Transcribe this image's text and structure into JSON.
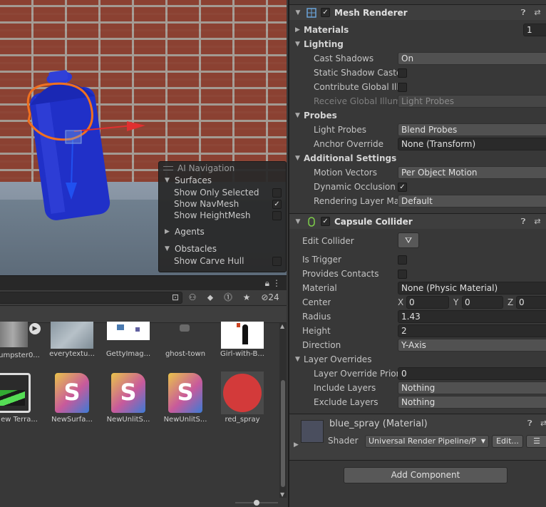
{
  "ai_navigation": {
    "title": "AI Navigation",
    "sections": {
      "surfaces": "Surfaces",
      "agents": "Agents",
      "obstacles": "Obstacles"
    },
    "options": {
      "show_only_selected": "Show Only Selected",
      "show_navmesh": "Show NavMesh",
      "show_heightmesh": "Show HeightMesh",
      "show_carve_hull": "Show Carve Hull"
    },
    "checked": {
      "show_only_selected": false,
      "show_navmesh": true,
      "show_heightmesh": false,
      "show_carve_hull": false
    }
  },
  "project": {
    "hidden_count": "24",
    "assets": [
      {
        "label": "umpster0...",
        "kind": "dumpster"
      },
      {
        "label": "everytextu...",
        "kind": "texture"
      },
      {
        "label": "GettyImag...",
        "kind": "image"
      },
      {
        "label": "ghost-town",
        "kind": "ghost"
      },
      {
        "label": "Girl-with-B...",
        "kind": "girl"
      },
      {
        "label": "ew Terra...",
        "kind": "terrain"
      },
      {
        "label": "NewSurfa...",
        "kind": "shader"
      },
      {
        "label": "NewUnlitS...",
        "kind": "shader"
      },
      {
        "label": "NewUnlitS...",
        "kind": "shader"
      },
      {
        "label": "red_spray",
        "kind": "material"
      }
    ]
  },
  "inspector": {
    "mesh_renderer": {
      "title": "Mesh Renderer",
      "materials_label": "Materials",
      "materials_count": "1",
      "lighting_label": "Lighting",
      "cast_shadows_label": "Cast Shadows",
      "cast_shadows_value": "On",
      "static_shadow_caster_label": "Static Shadow Caster",
      "contribute_gi_label": "Contribute Global Illumination",
      "receive_gi_label": "Receive Global Illumination",
      "receive_gi_value": "Light Probes",
      "probes_label": "Probes",
      "light_probes_label": "Light Probes",
      "light_probes_value": "Blend Probes",
      "anchor_override_label": "Anchor Override",
      "anchor_override_value": "None (Transform)",
      "additional_settings_label": "Additional Settings",
      "motion_vectors_label": "Motion Vectors",
      "motion_vectors_value": "Per Object Motion",
      "dynamic_occlusion_label": "Dynamic Occlusion",
      "rendering_layer_mask_label": "Rendering Layer Mask",
      "rendering_layer_mask_value": "Default"
    },
    "capsule_collider": {
      "title": "Capsule Collider",
      "edit_collider_label": "Edit Collider",
      "is_trigger_label": "Is Trigger",
      "provides_contacts_label": "Provides Contacts",
      "material_label": "Material",
      "material_value": "None (Physic Material)",
      "center_label": "Center",
      "center": {
        "x": "0",
        "y": "0",
        "z": "0"
      },
      "axis_labels": {
        "x": "X",
        "y": "Y",
        "z": "Z"
      },
      "radius_label": "Radius",
      "radius_value": "1.43",
      "height_label": "Height",
      "height_value": "2",
      "direction_label": "Direction",
      "direction_value": "Y-Axis",
      "layer_overrides_label": "Layer Overrides",
      "layer_override_priority_label": "Layer Override Priority",
      "layer_override_priority_value": "0",
      "include_layers_label": "Include Layers",
      "include_layers_value": "Nothing",
      "exclude_layers_label": "Exclude Layers",
      "exclude_layers_value": "Nothing"
    },
    "material": {
      "name": "blue_spray (Material)",
      "shader_label": "Shader",
      "shader_value": "Universal Render Pipeline/P",
      "edit_label": "Edit..."
    },
    "add_component_label": "Add Component"
  },
  "colors": {
    "spray_can": "#1f2fd0",
    "selection_outline": "#f07020",
    "gizmo_x": "#e03030",
    "gizmo_y": "#2050f0",
    "red_spray": "#d33a3a"
  }
}
